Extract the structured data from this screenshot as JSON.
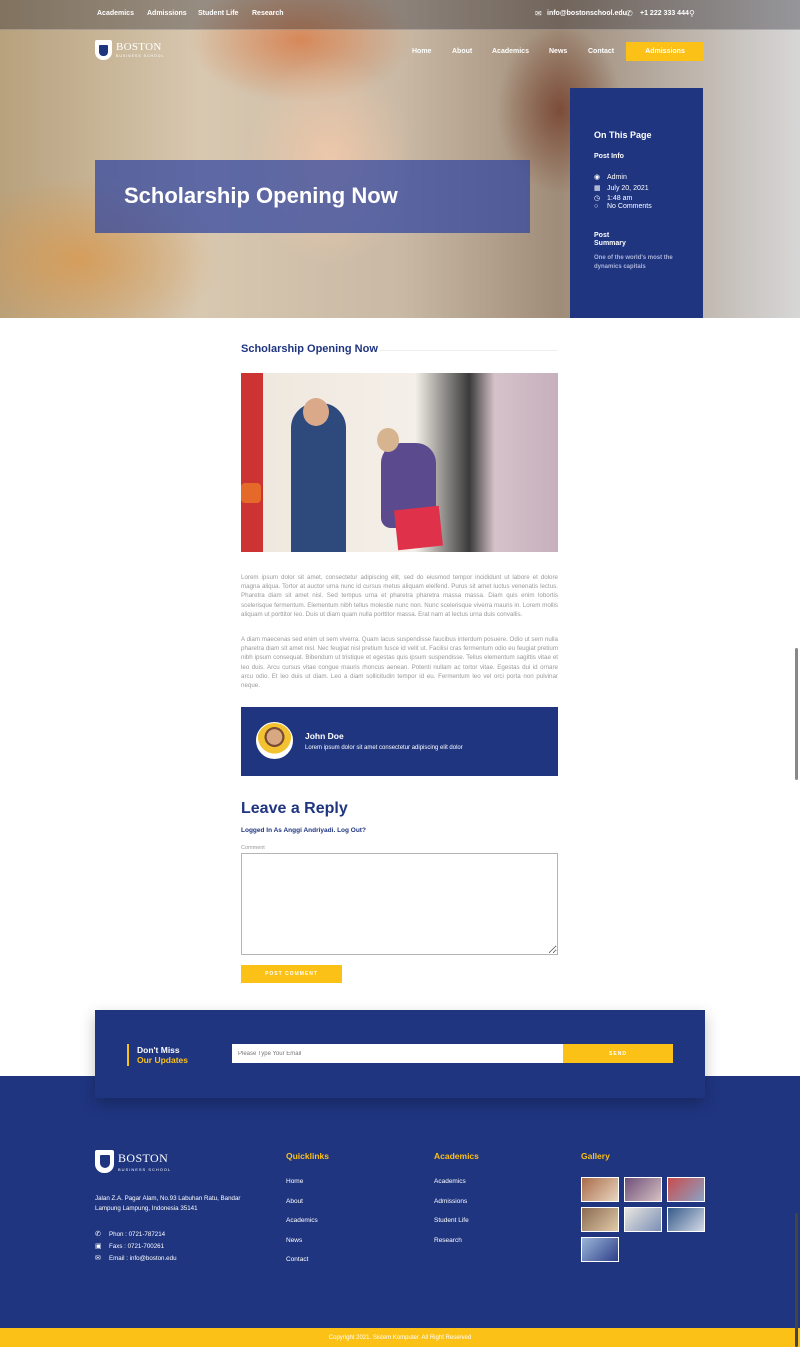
{
  "topbar": {
    "links": [
      "Academics",
      "Admissions",
      "Student Life",
      "Research"
    ],
    "email": "info@bostonschool.edu",
    "phone": "+1 222 333 444"
  },
  "logo": {
    "brand": "BOSTON",
    "sub": "BUSINESS SCHOOL"
  },
  "nav": {
    "items": [
      "Home",
      "About",
      "Academics",
      "News",
      "Contact"
    ],
    "cta": "Admissions"
  },
  "hero": {
    "title": "Scholarship Opening Now"
  },
  "sidebar": {
    "heading": "On This Page",
    "post_info": "Post Info",
    "author": "Admin",
    "date": "July 20, 2021",
    "time": "1:48 am",
    "comments": "No Comments",
    "summary_heading_1": "Post",
    "summary_heading_2": "Summary",
    "summary_text": "One of the world's most the dynamics capitals"
  },
  "post": {
    "heading": "Scholarship Opening Now",
    "paragraph_1": "Lorem ipsum dolor sit amet, consectetur adipiscing elit, sed do eiusmod tempor incididunt ut labore et dolore magna aliqua. Tortor at auctor urna nunc id cursus metus aliquam eleifend. Purus sit amet luctus venenatis lectus. Pharetra diam sit amet nisl. Sed tempus urna et pharetra pharetra massa massa. Diam quis enim lobortis scelerisque fermentum. Elementum nibh tellus molestie nunc non. Nunc scelerisque viverra mauris in. Lorem mollis aliquam ut porttitor leo. Duis ut diam quam nulla porttitor massa. Erat nam at lectus urna duis convallis.",
    "paragraph_2": "A diam maecenas sed enim ut sem viverra. Quam lacus suspendisse faucibus interdum posuere. Odio ut sem nulla pharetra diam sit amet nisl. Nec feugiat nisl pretium fusce id velit ut. Facilisi cras fermentum odio eu feugiat pretium nibh ipsum consequat. Bibendum ut tristique et egestas quis ipsum suspendisse. Tellus elementum sagittis vitae et leo duis. Arcu cursus vitae congue mauris rhoncus aenean. Potenti nullam ac tortor vitae. Egestas dui id ornare arcu odio. Et leo duis ut diam. Leo a diam sollicitudin tempor id eu. Fermentum leo vel orci porta non pulvinar neque."
  },
  "author": {
    "name": "John Doe",
    "bio": "Lorem ipsum dolor sit amet consectetur adipiscing elit dolor"
  },
  "reply": {
    "heading": "Leave a Reply",
    "logged_in": "Logged In As Anggi Andriyadi.",
    "logout": "Log Out?",
    "comment_label": "Comment",
    "submit": "POST COMMENT"
  },
  "newsletter": {
    "line1": "Don't Miss",
    "line2": "Our Updates",
    "placeholder": "Please Type Your Email",
    "send": "SEND"
  },
  "footer": {
    "address": "Jalan Z.A. Pagar Alam, No.93 Labuhan Ratu, Bandar Lampung Lampung, Indonesia 35141",
    "phone": "Phon : 0721-787214",
    "fax": "Faxs : 0721-700261",
    "email": "Email : info@boston.edu",
    "quicklinks_heading": "Quicklinks",
    "quicklinks": [
      "Home",
      "About",
      "Academics",
      "News",
      "Contact"
    ],
    "academics_heading": "Academics",
    "academics": [
      "Academics",
      "Admissions",
      "Student Life",
      "Research"
    ],
    "gallery_heading": "Gallery",
    "copyright": "Copyright 2021. Sistem Komputer. All Right Reserved"
  },
  "colors": {
    "primary": "#1f3580",
    "accent": "#fcc117"
  }
}
